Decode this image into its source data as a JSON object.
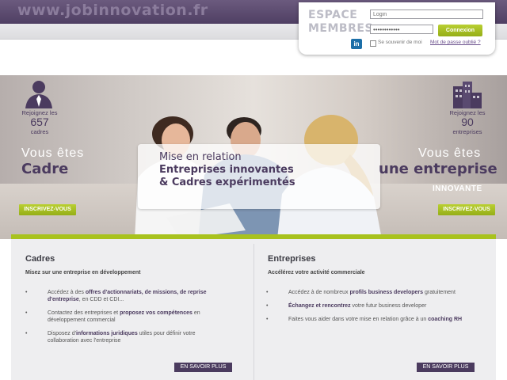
{
  "header": {
    "site_url": "www.jobinnovation.fr"
  },
  "login": {
    "title_line1": "ESPACE",
    "title_line2": "MEMBRES",
    "login_placeholder": "Login",
    "password_value": "••••••••••••",
    "connexion_label": "Connexion",
    "linkedin_label": "in",
    "remember_label": "Se souvenir de moi",
    "forgot_label": "Mot de passe oublié ?"
  },
  "hero": {
    "headline": {
      "line1": "Mise en relation",
      "line2": "Entreprises innovantes",
      "line3": "& Cadres expérimentés"
    },
    "left": {
      "join_label": "Rejoignez les",
      "count": "657",
      "unit": "cadres",
      "vous": "Vous êtes",
      "title": "Cadre",
      "button": "INSCRIVEZ-VOUS"
    },
    "right": {
      "join_label": "Rejoignez les",
      "count": "90",
      "unit": "entreprises",
      "vous": "Vous êtes",
      "title": "une entreprise",
      "subtitle": "INNOVANTE",
      "button": "INSCRIVEZ-VOUS"
    }
  },
  "panels": {
    "cadres": {
      "title": "Cadres",
      "subtitle": "Misez sur une entreprise en développement",
      "items": [
        {
          "pre": "Accédez à des ",
          "bold": "offres d'actionnariats, de missions, de reprise d'entreprise",
          "post": ", en CDD et CDI..."
        },
        {
          "pre": "Contactez des entreprises et ",
          "bold": "proposez vos compétences",
          "post": " en développement commercial"
        },
        {
          "pre": "Disposez d'",
          "bold": "informations juridiques",
          "post": " utiles pour définir votre collaboration avec l'entreprise"
        }
      ],
      "button": "EN SAVOIR PLUS"
    },
    "entreprises": {
      "title": "Entreprises",
      "subtitle": "Accélérez votre activité commerciale",
      "items": [
        {
          "pre": "Accédez à de nombreux ",
          "bold": "profils business developers",
          "post": " gratuitement"
        },
        {
          "pre": "",
          "bold": "Échangez et rencontrez",
          "post": " votre futur business developer"
        },
        {
          "pre": "Faites vous aider dans votre mise en relation grâce à un ",
          "bold": "coaching RH",
          "post": ""
        }
      ],
      "button": "EN SAVOIR PLUS"
    }
  }
}
